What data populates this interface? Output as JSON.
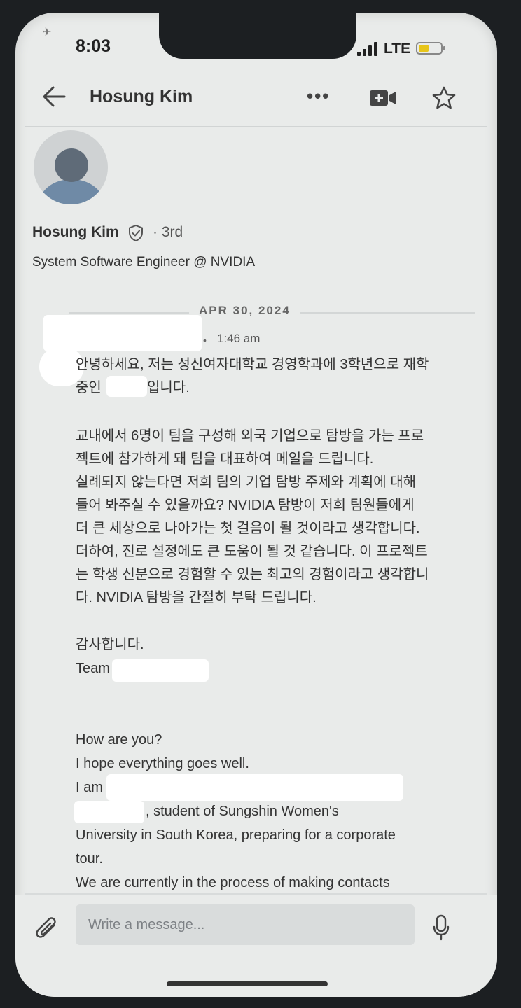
{
  "status_bar": {
    "time": "8:03",
    "network": "LTE"
  },
  "header": {
    "title": "Hosung Kim",
    "more": "•••"
  },
  "profile": {
    "name": "Hosung Kim",
    "degree": "· 3rd",
    "headline": "System Software Engineer @ NVIDIA"
  },
  "conversation": {
    "date": "APR 30, 2024",
    "message": {
      "time": "1:46 am",
      "lines": [
        "안녕하세요, 저는 성신여자대학교 경영학과에 3학년으로 재학",
        "입니다.",
        "중인",
        "교내에서 6명이 팀을 구성해 외국 기업으로 탐방을 가는 프로",
        "젝트에 참가하게 돼 팀을 대표하여 메일을 드립니다.",
        "실례되지 않는다면 저희 팀의 기업 탐방 주제와 계획에 대해",
        "들어 봐주실 수 있을까요? NVIDIA 탐방이 저희 팀원들에게",
        "더 큰 세상으로 나아가는 첫 걸음이 될 것이라고 생각합니다.",
        "더하여, 진로 설정에도 큰 도움이 될 것 같습니다. 이 프로젝트",
        "는 학생 신분으로 경험할 수 있는 최고의 경험이라고 생각합니",
        "다. NVIDIA 탐방을 간절히 부탁 드립니다.",
        "감사합니다.",
        "Team",
        "How are you?",
        "I hope everything goes well.",
        "I am",
        ", student of Sungshin Women's",
        "University in South Korea, preparing for a corporate",
        "tour.",
        "We are currently in the process of making contacts"
      ]
    }
  },
  "composer": {
    "placeholder": "Write a message..."
  }
}
